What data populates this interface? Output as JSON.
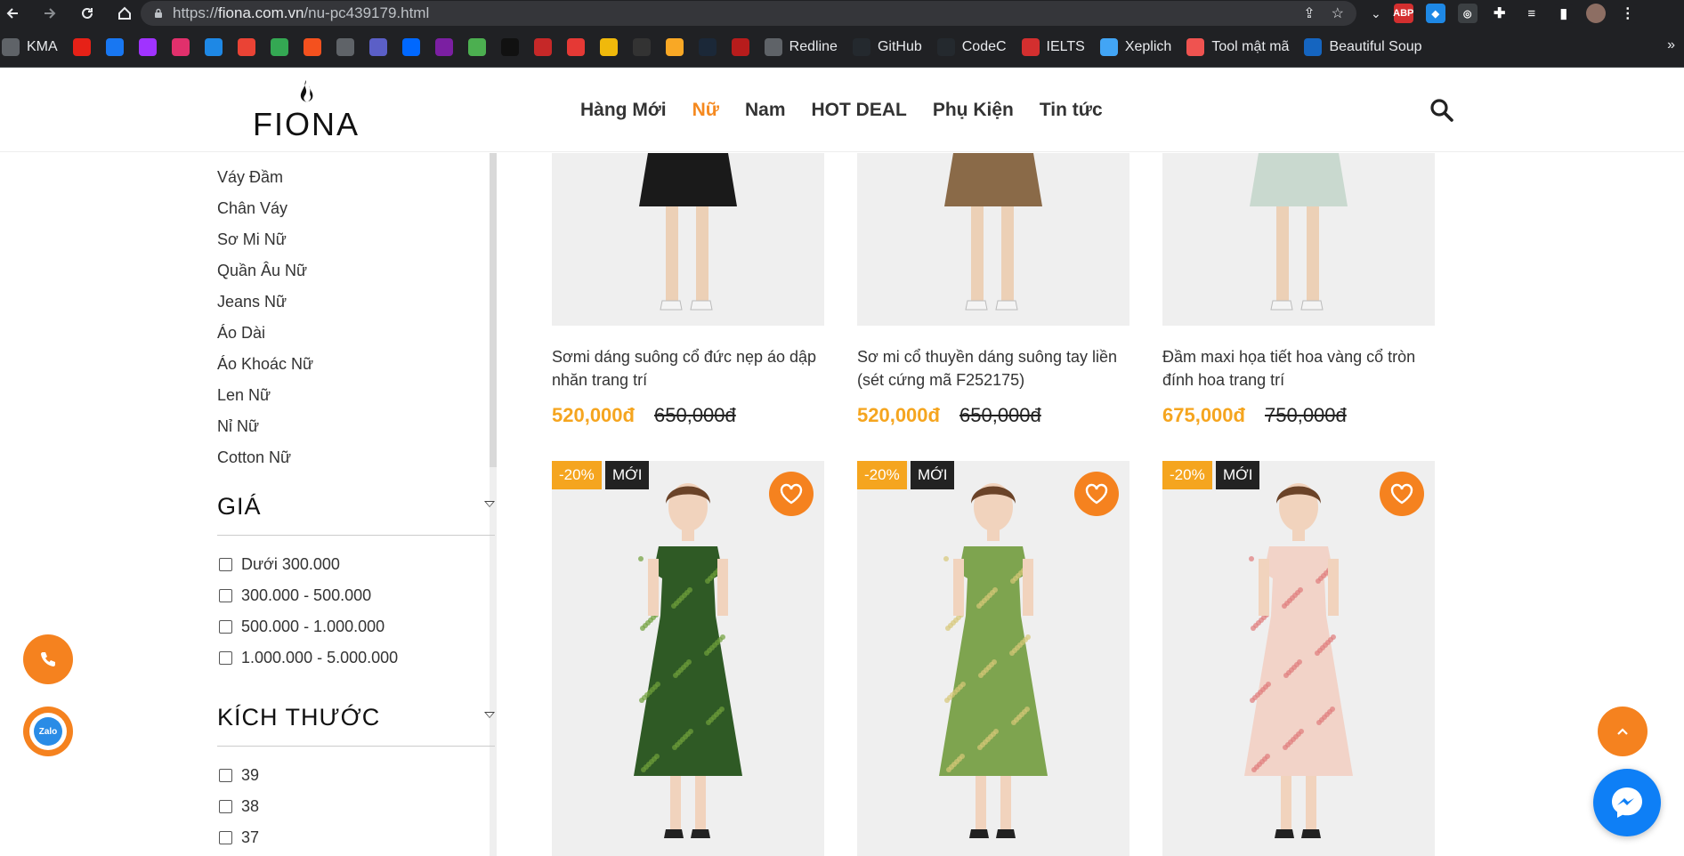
{
  "browser": {
    "url_prefix": "https://",
    "url_host": "fiona.com.vn",
    "url_path": "/nu-pc439179.html",
    "bookmarks": [
      {
        "label": "KMA",
        "color": "#5f6368"
      },
      {
        "label": "",
        "color": "#e62117"
      },
      {
        "label": "",
        "color": "#1877f2"
      },
      {
        "label": "",
        "color": "#a033ff"
      },
      {
        "label": "",
        "color": "#e1306c"
      },
      {
        "label": "",
        "color": "#1e88e5"
      },
      {
        "label": "",
        "color": "#ea4335"
      },
      {
        "label": "",
        "color": "#34a853"
      },
      {
        "label": "",
        "color": "#f4511e"
      },
      {
        "label": "",
        "color": "#5f6368"
      },
      {
        "label": "",
        "color": "#5b5fc7"
      },
      {
        "label": "",
        "color": "#0068ff"
      },
      {
        "label": "",
        "color": "#7b1fa2"
      },
      {
        "label": "",
        "color": "#4caf50"
      },
      {
        "label": "",
        "color": "#111111"
      },
      {
        "label": "",
        "color": "#c62828"
      },
      {
        "label": "",
        "color": "#e53935"
      },
      {
        "label": "",
        "color": "#f0b90b"
      },
      {
        "label": "",
        "color": "#333333"
      },
      {
        "label": "",
        "color": "#f9a825"
      },
      {
        "label": "",
        "color": "#1b2838"
      },
      {
        "label": "",
        "color": "#b71c1c"
      },
      {
        "label": "Redline",
        "color": "#5f6368"
      },
      {
        "label": "GitHub",
        "color": "#24292e"
      },
      {
        "label": "CodeC",
        "color": "#24292e"
      },
      {
        "label": "IELTS",
        "color": "#d32f2f"
      },
      {
        "label": "Xeplich",
        "color": "#42a5f5"
      },
      {
        "label": "Tool mật mã",
        "color": "#ef5350"
      },
      {
        "label": "Beautiful Soup",
        "color": "#1565c0"
      }
    ]
  },
  "header": {
    "logo_text": "FIONA",
    "menu": [
      {
        "label": "Hàng Mới",
        "active": false
      },
      {
        "label": "Nữ",
        "active": true
      },
      {
        "label": "Nam",
        "active": false
      },
      {
        "label": "HOT DEAL",
        "active": false
      },
      {
        "label": "Phụ Kiện",
        "active": false
      },
      {
        "label": "Tin tức",
        "active": false
      }
    ],
    "accent_color": "#f5891f"
  },
  "sidebar": {
    "categories": [
      "Váy Đầm",
      "Chân Váy",
      "Sơ Mi Nữ",
      "Quần Âu Nữ",
      "Jeans Nữ",
      "Áo Dài",
      "Áo Khoác Nữ",
      "Len Nữ",
      "Nỉ Nữ",
      "Cotton Nữ"
    ],
    "price_filter": {
      "title": "GIÁ",
      "options": [
        "Dưới 300.000",
        "300.000 - 500.000",
        "500.000 - 1.000.000",
        "1.000.000 - 5.000.000"
      ]
    },
    "size_filter": {
      "title": "KÍCH THƯỚC",
      "options": [
        "39",
        "38",
        "37"
      ]
    }
  },
  "products_top": [
    {
      "title": "Sơmi dáng suông cổ đức nẹp áo dập nhăn trang trí",
      "price": "520,000đ",
      "old_price": "650,000đ",
      "dress": "#1a1a1a"
    },
    {
      "title": "Sơ mi cổ thuyền dáng suông tay liền (sét cứng mã F252175)",
      "price": "520,000đ",
      "old_price": "650,000đ",
      "dress": "#8a6a48"
    },
    {
      "title": "Đầm maxi họa tiết hoa vàng cổ tròn đính hoa trang trí",
      "price": "675,000đ",
      "old_price": "750,000đ",
      "dress": "#c9d9cf"
    }
  ],
  "products_bottom": [
    {
      "discount": "-20%",
      "new_label": "MỚI",
      "dress": "#2f5a25",
      "accent": "#6fa03a"
    },
    {
      "discount": "-20%",
      "new_label": "MỚI",
      "dress": "#7ea44f",
      "accent": "#d7c777"
    },
    {
      "discount": "-20%",
      "new_label": "MỚI",
      "dress": "#f2d3c8",
      "accent": "#e07a7a"
    }
  ],
  "widgets": {
    "zalo_label": "Zalo"
  }
}
